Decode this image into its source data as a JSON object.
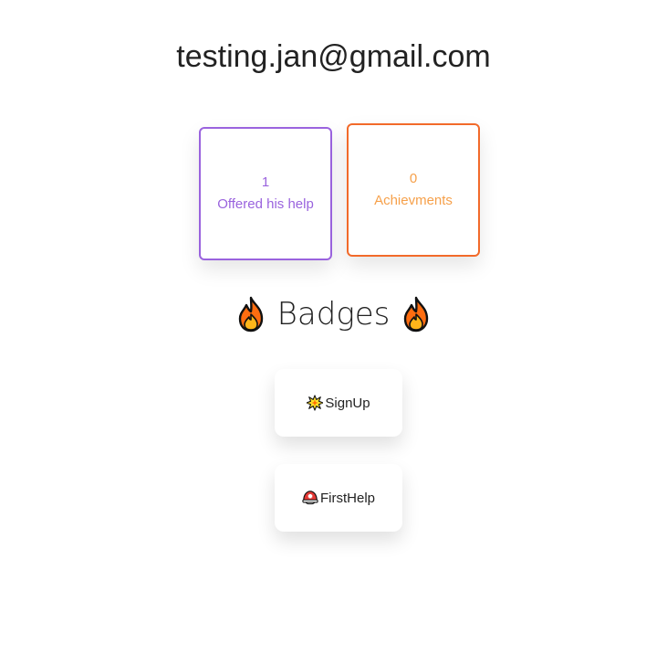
{
  "profile": {
    "email": "testing.jan@gmail.com"
  },
  "stats": {
    "help": {
      "count": "1",
      "label": "Offered his help",
      "color": "#9a63de"
    },
    "achievements": {
      "count": "0",
      "label": "Achievments",
      "border_color": "#f26a2a",
      "text_color": "#f6a04a"
    }
  },
  "badges": {
    "title": "Badges",
    "title_icon": "fire-icon",
    "items": [
      {
        "label": "SignUp",
        "icon": "collision-icon"
      },
      {
        "label": "FirstHelp",
        "icon": "rescue-helmet-icon"
      }
    ]
  }
}
